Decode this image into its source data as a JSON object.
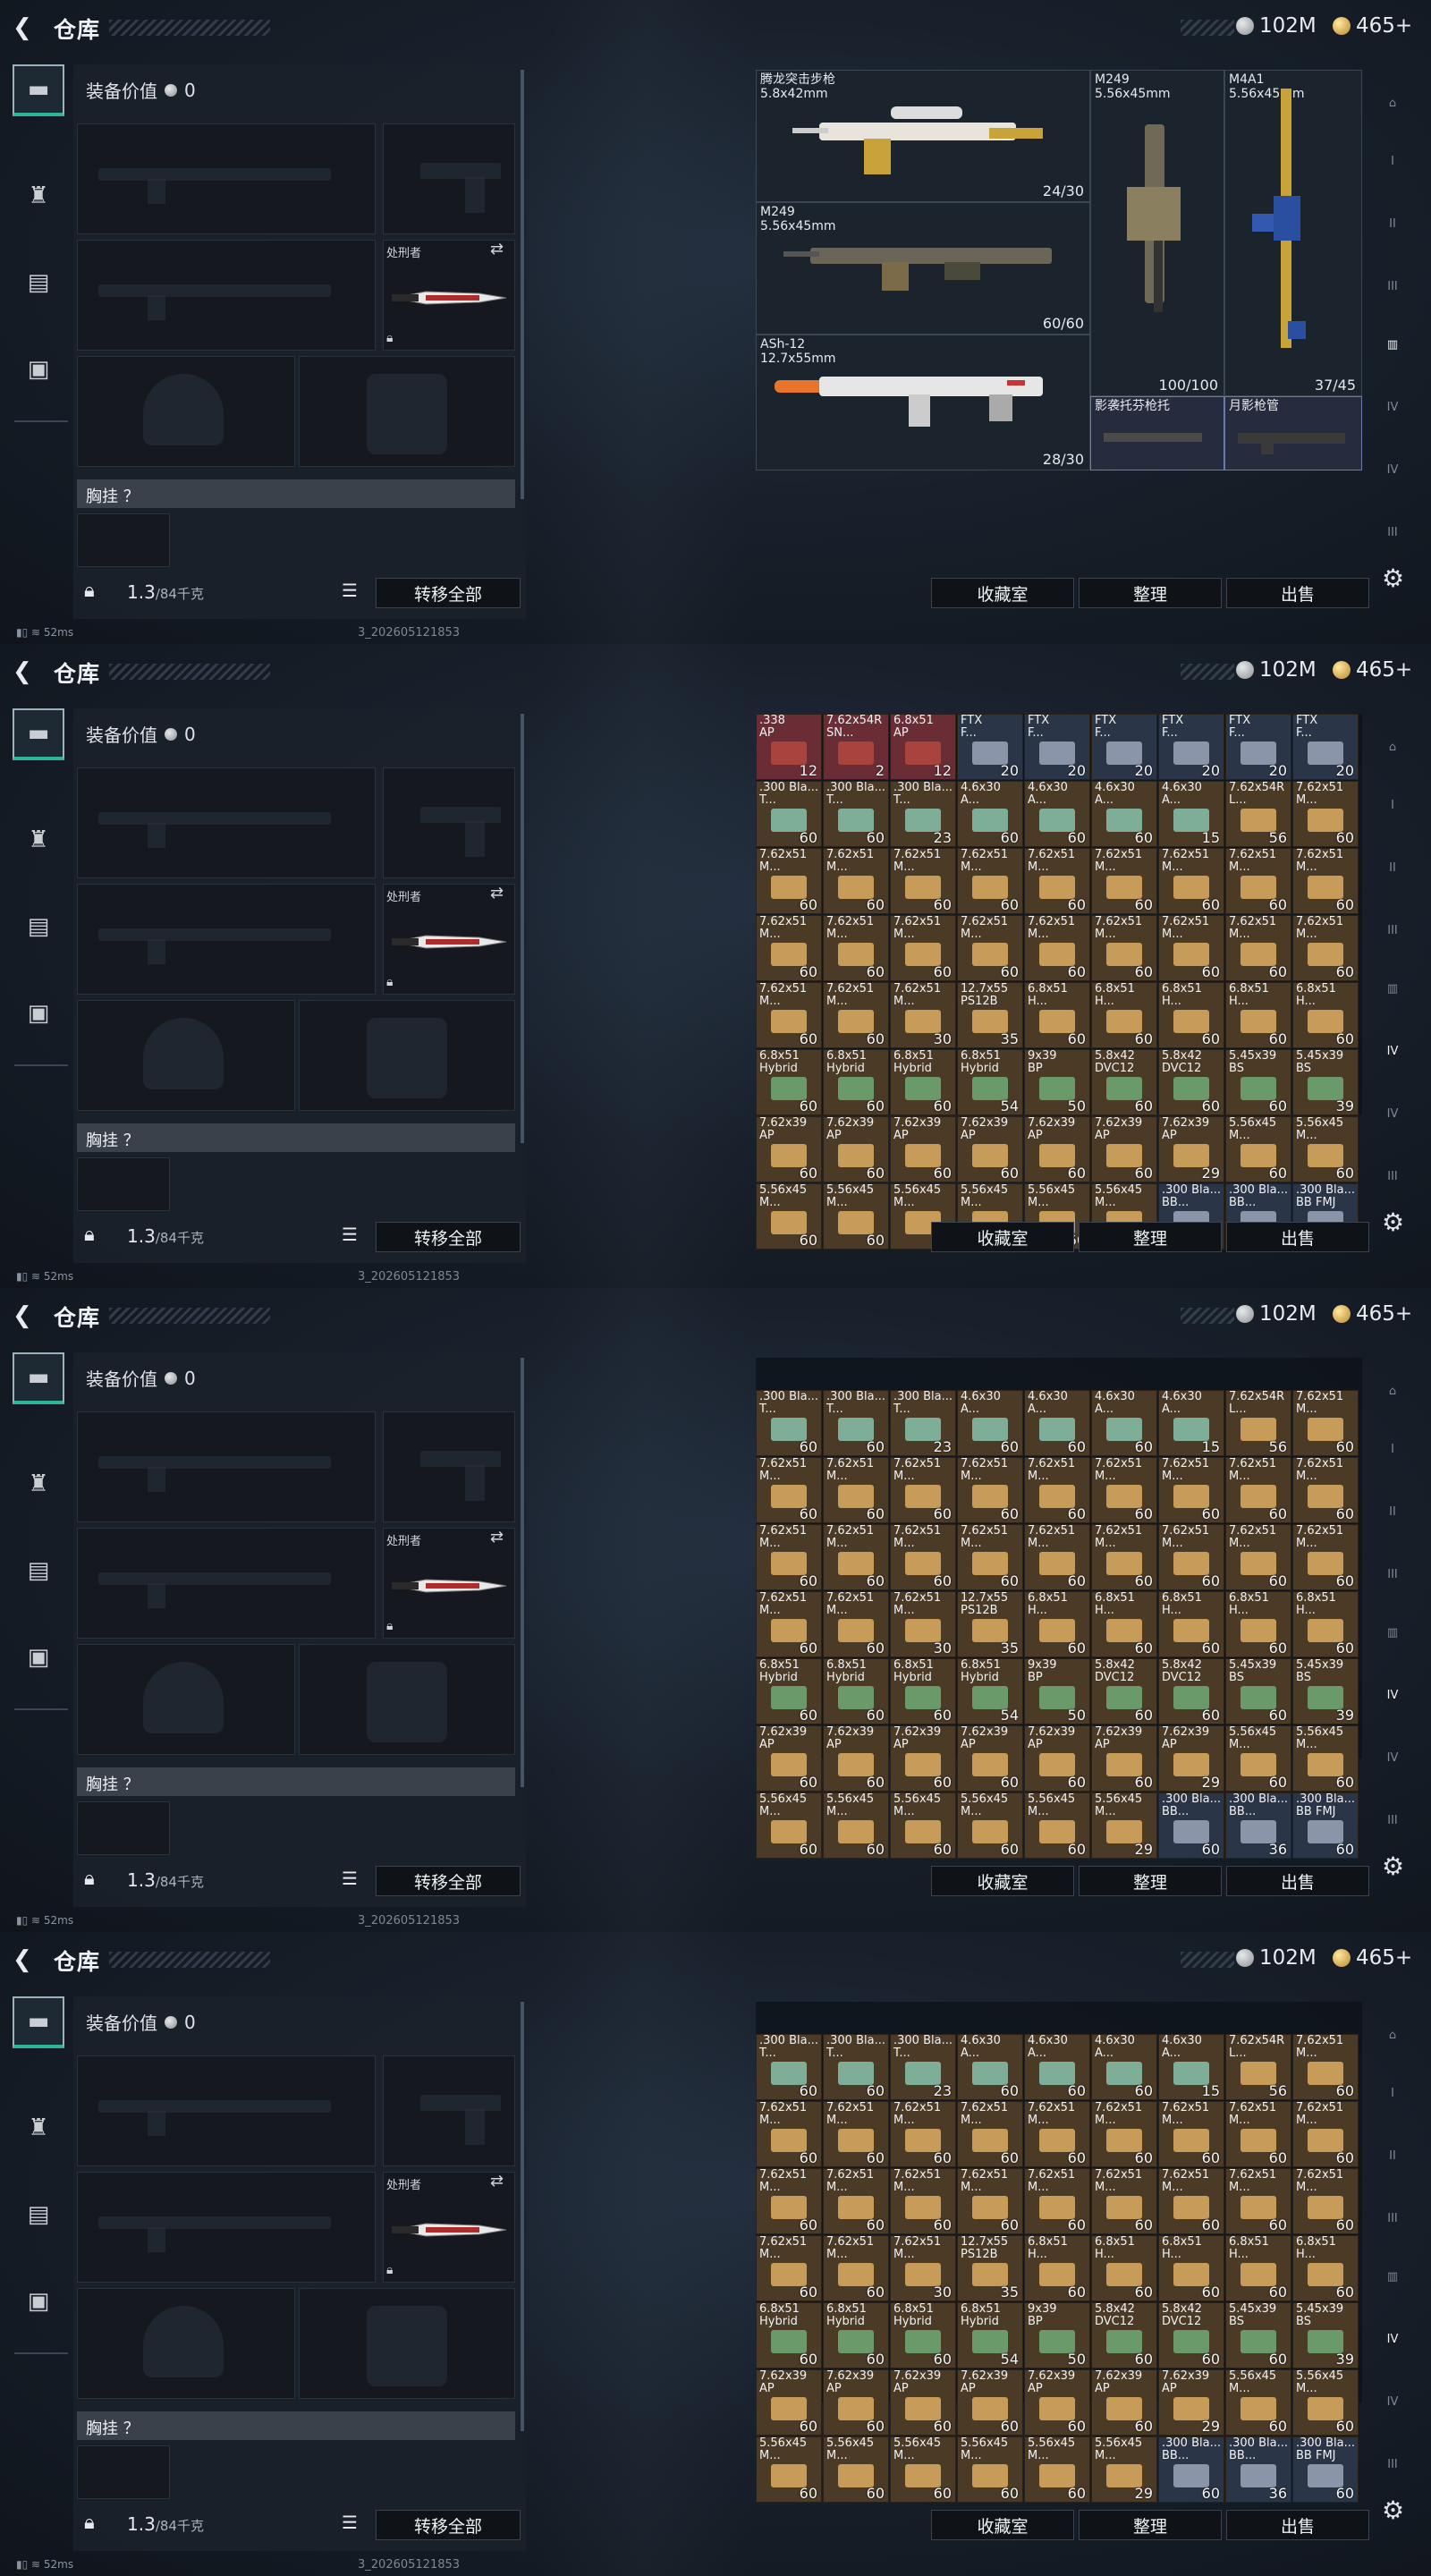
{
  "app": {
    "title": "仓库",
    "silver": "102M",
    "gold": "465+"
  },
  "left": {
    "equip_value_label": "装备价值",
    "equip_value": "0",
    "melee_label": "处刑者",
    "chest_label": "胸挂 ？",
    "weight": "1.3",
    "weight_max": "/84千克",
    "transfer_all": "转移全部"
  },
  "status": {
    "ping": "52ms",
    "stamp": "3_202605121853"
  },
  "actions": {
    "collect": "收藏室",
    "sort": "整理",
    "sell": "出售"
  },
  "weapons": [
    {
      "name": "腾龙突击步枪\n5.8x42mm",
      "count": "24/30"
    },
    {
      "name": "M249\n5.56x45mm",
      "count": "100/100"
    },
    {
      "name": "M4A1\n5.56x45mm",
      "count": "37/45"
    },
    {
      "name": "M249\n5.56x45mm",
      "count": "60/60"
    },
    {
      "name": "ASh-12\n12.7x55mm",
      "count": "28/30"
    },
    {
      "name": "影袭托芬枪托",
      "count": ""
    },
    {
      "name": "月影枪管",
      "count": ""
    }
  ],
  "ammo_rows": [
    [
      {
        "l": ".338",
        "l2": "AP",
        "c": "12",
        "t": "red"
      },
      {
        "l": "7.62x54R",
        "l2": "SN...",
        "c": "2",
        "t": "red"
      },
      {
        "l": "6.8x51",
        "l2": "AP",
        "c": "12",
        "t": "red"
      },
      {
        "l": "FTX",
        "l2": "F...",
        "c": "20",
        "t": "blue"
      },
      {
        "l": "FTX",
        "l2": "F...",
        "c": "20",
        "t": "blue"
      },
      {
        "l": "FTX",
        "l2": "F...",
        "c": "20",
        "t": "blue"
      },
      {
        "l": "FTX",
        "l2": "F...",
        "c": "20",
        "t": "blue"
      },
      {
        "l": "FTX",
        "l2": "F...",
        "c": "20",
        "t": "blue"
      },
      {
        "l": "FTX",
        "l2": "F...",
        "c": "20",
        "t": "blue"
      }
    ],
    [
      {
        "l": ".300 Bla...",
        "l2": "T...",
        "c": "60"
      },
      {
        "l": ".300 Bla...",
        "l2": "T...",
        "c": "60"
      },
      {
        "l": ".300 Bla...",
        "l2": "T...",
        "c": "23"
      },
      {
        "l": "4.6x30",
        "l2": "A...",
        "c": "60"
      },
      {
        "l": "4.6x30",
        "l2": "A...",
        "c": "60"
      },
      {
        "l": "4.6x30",
        "l2": "A...",
        "c": "60"
      },
      {
        "l": "4.6x30",
        "l2": "A...",
        "c": "15"
      },
      {
        "l": "7.62x54R",
        "l2": "L...",
        "c": "56"
      },
      {
        "l": "7.62x51",
        "l2": "M...",
        "c": "60"
      }
    ],
    [
      {
        "l": "7.62x51",
        "l2": "M...",
        "c": "60"
      },
      {
        "l": "7.62x51",
        "l2": "M...",
        "c": "60"
      },
      {
        "l": "7.62x51",
        "l2": "M...",
        "c": "60"
      },
      {
        "l": "7.62x51",
        "l2": "M...",
        "c": "60"
      },
      {
        "l": "7.62x51",
        "l2": "M...",
        "c": "60"
      },
      {
        "l": "7.62x51",
        "l2": "M...",
        "c": "60"
      },
      {
        "l": "7.62x51",
        "l2": "M...",
        "c": "60"
      },
      {
        "l": "7.62x51",
        "l2": "M...",
        "c": "60"
      },
      {
        "l": "7.62x51",
        "l2": "M...",
        "c": "60"
      }
    ],
    [
      {
        "l": "7.62x51",
        "l2": "M...",
        "c": "60"
      },
      {
        "l": "7.62x51",
        "l2": "M...",
        "c": "60"
      },
      {
        "l": "7.62x51",
        "l2": "M...",
        "c": "60"
      },
      {
        "l": "7.62x51",
        "l2": "M...",
        "c": "60"
      },
      {
        "l": "7.62x51",
        "l2": "M...",
        "c": "60"
      },
      {
        "l": "7.62x51",
        "l2": "M...",
        "c": "60"
      },
      {
        "l": "7.62x51",
        "l2": "M...",
        "c": "60"
      },
      {
        "l": "7.62x51",
        "l2": "M...",
        "c": "60"
      },
      {
        "l": "7.62x51",
        "l2": "M...",
        "c": "60"
      }
    ],
    [
      {
        "l": "7.62x51",
        "l2": "M...",
        "c": "60"
      },
      {
        "l": "7.62x51",
        "l2": "M...",
        "c": "60"
      },
      {
        "l": "7.62x51",
        "l2": "M...",
        "c": "30"
      },
      {
        "l": "12.7x55",
        "l2": "PS12B",
        "c": "35"
      },
      {
        "l": "6.8x51",
        "l2": "H...",
        "c": "60"
      },
      {
        "l": "6.8x51",
        "l2": "H...",
        "c": "60"
      },
      {
        "l": "6.8x51",
        "l2": "H...",
        "c": "60"
      },
      {
        "l": "6.8x51",
        "l2": "H...",
        "c": "60"
      },
      {
        "l": "6.8x51",
        "l2": "H...",
        "c": "60"
      }
    ],
    [
      {
        "l": "6.8x51",
        "l2": "Hybrid",
        "c": "60"
      },
      {
        "l": "6.8x51",
        "l2": "Hybrid",
        "c": "60"
      },
      {
        "l": "6.8x51",
        "l2": "Hybrid",
        "c": "60"
      },
      {
        "l": "6.8x51",
        "l2": "Hybrid",
        "c": "54"
      },
      {
        "l": "9x39",
        "l2": "BP",
        "c": "50"
      },
      {
        "l": "5.8x42",
        "l2": "DVC12",
        "c": "60"
      },
      {
        "l": "5.8x42",
        "l2": "DVC12",
        "c": "60"
      },
      {
        "l": "5.45x39",
        "l2": "BS",
        "c": "60"
      },
      {
        "l": "5.45x39",
        "l2": "BS",
        "c": "39"
      }
    ],
    [
      {
        "l": "7.62x39",
        "l2": "AP",
        "c": "60"
      },
      {
        "l": "7.62x39",
        "l2": "AP",
        "c": "60"
      },
      {
        "l": "7.62x39",
        "l2": "AP",
        "c": "60"
      },
      {
        "l": "7.62x39",
        "l2": "AP",
        "c": "60"
      },
      {
        "l": "7.62x39",
        "l2": "AP",
        "c": "60"
      },
      {
        "l": "7.62x39",
        "l2": "AP",
        "c": "60"
      },
      {
        "l": "7.62x39",
        "l2": "AP",
        "c": "29"
      },
      {
        "l": "5.56x45",
        "l2": "M...",
        "c": "60"
      },
      {
        "l": "5.56x45",
        "l2": "M...",
        "c": "60"
      }
    ],
    [
      {
        "l": "5.56x45",
        "l2": "M...",
        "c": "60"
      },
      {
        "l": "5.56x45",
        "l2": "M...",
        "c": "60"
      },
      {
        "l": "5.56x45",
        "l2": "M...",
        "c": "60"
      },
      {
        "l": "5.56x45",
        "l2": "M...",
        "c": "60"
      },
      {
        "l": "5.56x45",
        "l2": "M...",
        "c": "60"
      },
      {
        "l": "5.56x45",
        "l2": "M...",
        "c": "29"
      },
      {
        "l": ".300 Bla...",
        "l2": "BB...",
        "c": "60",
        "t": "blue"
      },
      {
        "l": ".300 Bla...",
        "l2": "BB...",
        "c": "36",
        "t": "blue"
      },
      {
        "l": ".300 Bla...",
        "l2": "BB FMJ",
        "c": "60",
        "t": "blue"
      }
    ]
  ],
  "colors": {
    "box_tan": "#c69c58",
    "box_green": "#6a9a6a",
    "box_blue": "#8b95aa",
    "box_red": "#a9433e"
  }
}
